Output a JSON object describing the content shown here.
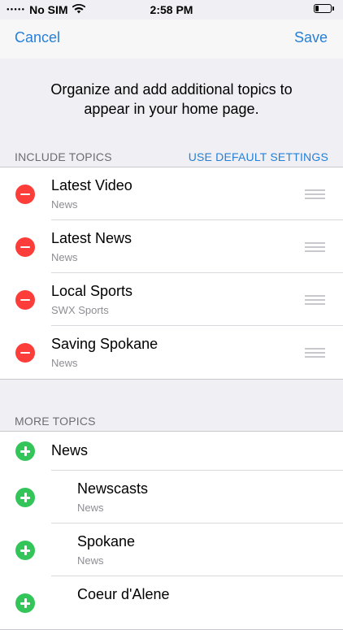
{
  "status": {
    "carrier": "No SIM",
    "time": "2:58 PM"
  },
  "nav": {
    "cancel": "Cancel",
    "save": "Save"
  },
  "intro": "Organize and add additional topics to appear in your home page.",
  "include": {
    "header": "INCLUDE TOPICS",
    "action": "USE DEFAULT SETTINGS",
    "items": [
      {
        "title": "Latest Video",
        "subtitle": "News"
      },
      {
        "title": "Latest News",
        "subtitle": "News"
      },
      {
        "title": "Local Sports",
        "subtitle": "SWX Sports"
      },
      {
        "title": "Saving Spokane",
        "subtitle": "News"
      }
    ]
  },
  "more": {
    "header": "MORE TOPICS",
    "items": [
      {
        "title": "News"
      },
      {
        "title": "Newscasts",
        "subtitle": "News"
      },
      {
        "title": "Spokane",
        "subtitle": "News"
      },
      {
        "title": "Coeur d'Alene"
      }
    ]
  },
  "colors": {
    "accent": "#2680d8",
    "remove": "#fc3d39",
    "add": "#33c559"
  }
}
